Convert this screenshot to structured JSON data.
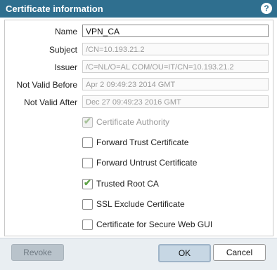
{
  "dialog": {
    "title": "Certificate information",
    "help_icon": "question-icon"
  },
  "fields": {
    "name": {
      "label": "Name",
      "value": "VPN_CA"
    },
    "subject": {
      "label": "Subject",
      "value": "/CN=10.193.21.2"
    },
    "issuer": {
      "label": "Issuer",
      "value": "/C=NL/O=AL COM/OU=IT/CN=10.193.21.2"
    },
    "not_valid_before": {
      "label": "Not Valid Before",
      "value": "Apr  2 09:49:23 2014 GMT"
    },
    "not_valid_after": {
      "label": "Not Valid After",
      "value": "Dec 27 09:49:23 2016 GMT"
    }
  },
  "checkboxes": [
    {
      "label": "Certificate Authority",
      "checked": true,
      "disabled": true
    },
    {
      "label": "Forward Trust Certificate",
      "checked": false,
      "disabled": false
    },
    {
      "label": "Forward Untrust Certificate",
      "checked": false,
      "disabled": false
    },
    {
      "label": "Trusted Root CA",
      "checked": true,
      "disabled": false
    },
    {
      "label": "SSL Exclude Certificate",
      "checked": false,
      "disabled": false
    },
    {
      "label": "Certificate for Secure Web GUI",
      "checked": false,
      "disabled": false
    }
  ],
  "buttons": {
    "revoke": "Revoke",
    "ok": "OK",
    "cancel": "Cancel"
  },
  "colors": {
    "titlebar": "#2f6f8f",
    "check": "#5ea345"
  }
}
